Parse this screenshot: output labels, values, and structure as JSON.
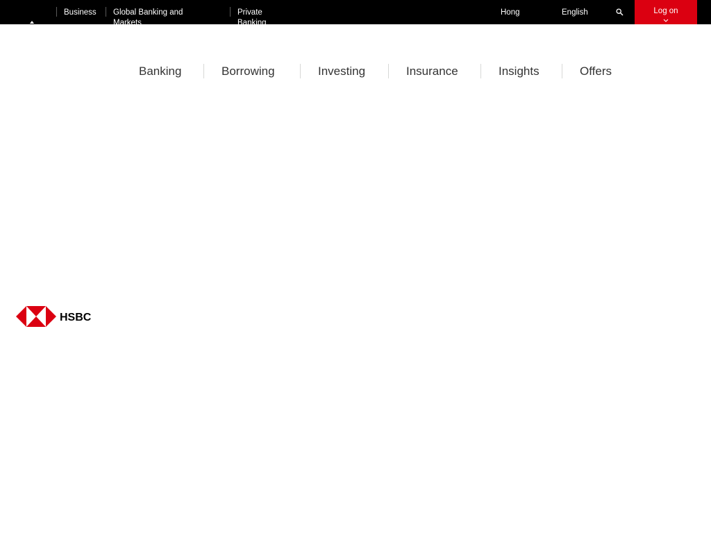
{
  "topbar": {
    "segments": [
      "Business",
      "Global Banking and Markets",
      "Private Banking"
    ],
    "region": "Hong",
    "language": "English",
    "logon_label": "Log on"
  },
  "nav": {
    "items": [
      "Banking",
      "Borrowing",
      "Investing",
      "Insurance",
      "Insights",
      "Offers"
    ]
  },
  "logo": {
    "text": "HSBC"
  },
  "icons": {
    "search": "search-icon",
    "logon_chevron": "chevron-down-icon",
    "active_tab": "caret-up-icon",
    "logo_mark": "hsbc-hexagon-icon"
  },
  "colors": {
    "topbar": "#000000",
    "brand_red": "#db0011",
    "nav_text": "#333333",
    "separator": "#d7d8d6"
  }
}
